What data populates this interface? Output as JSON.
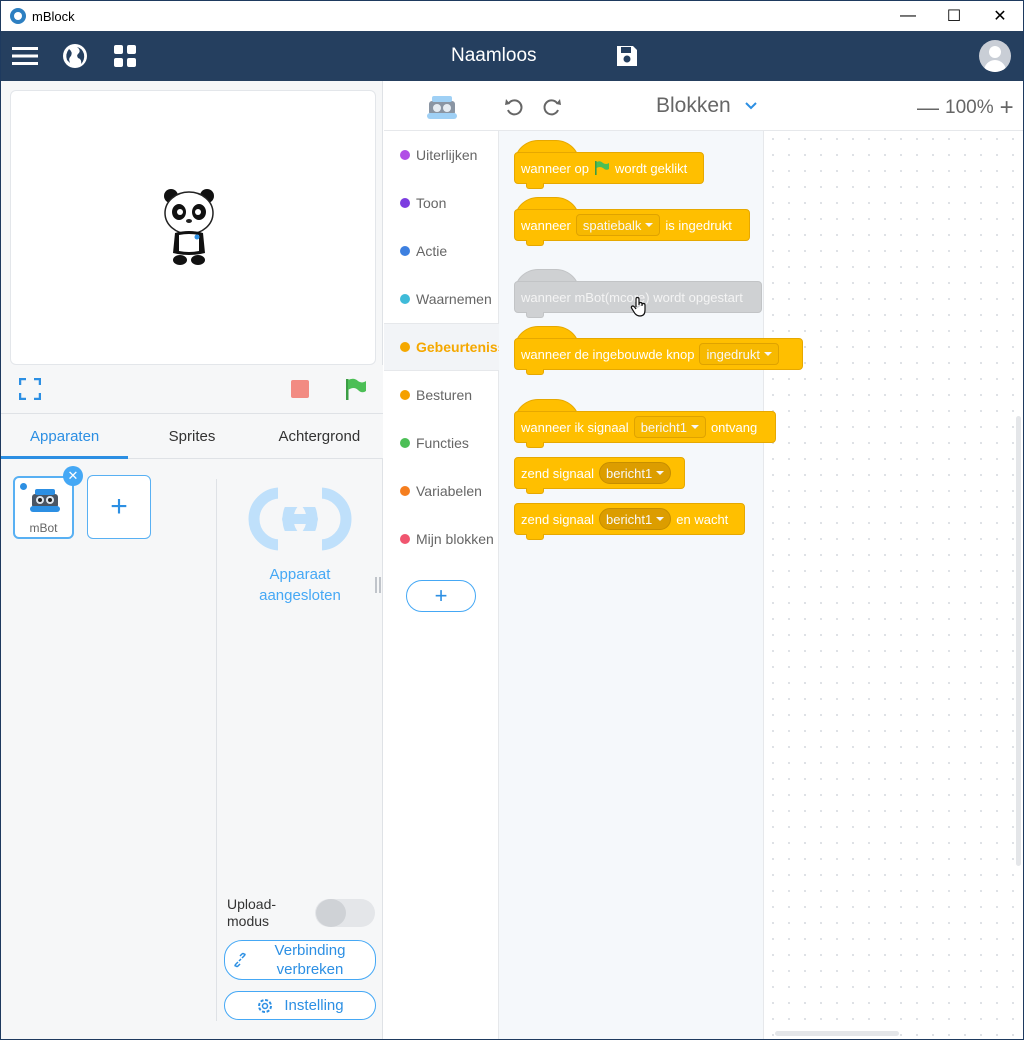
{
  "window": {
    "title": "mBlock",
    "minimize": "—",
    "maximize": "☐",
    "close": "✕"
  },
  "topbar": {
    "doc_title": "Naamloos"
  },
  "tabs": [
    {
      "label": "Apparaten"
    },
    {
      "label": "Sprites"
    },
    {
      "label": "Achtergrond"
    }
  ],
  "device": {
    "name": "mBot"
  },
  "connection": {
    "line1": "Apparaat",
    "line2": "aangesloten"
  },
  "upload": {
    "line1": "Upload-",
    "line2": "modus"
  },
  "buttons": {
    "disconnect_line1": "Verbinding",
    "disconnect_line2": "verbreken",
    "settings": "Instelling"
  },
  "editor": {
    "mode": "Blokken",
    "zoom": "100%"
  },
  "categories": [
    {
      "label": "Uiterlijken",
      "color": "#b14de6"
    },
    {
      "label": "Toon",
      "color": "#7c3de0"
    },
    {
      "label": "Actie",
      "color": "#3d80e0"
    },
    {
      "label": "Waarnemen",
      "color": "#3fbbd9"
    },
    {
      "label": "Gebeurtenissen",
      "color": "#f5a800"
    },
    {
      "label": "Besturen",
      "color": "#f5a000"
    },
    {
      "label": "Functies",
      "color": "#4cbf56"
    },
    {
      "label": "Variabelen",
      "color": "#f57e1f"
    },
    {
      "label": "Mijn blokken",
      "color": "#f0556f"
    }
  ],
  "blocks": {
    "b1": {
      "pre": "wanneer op",
      "post": "wordt geklikt"
    },
    "b2": {
      "pre": "wanneer",
      "dropdown": "spatiebalk",
      "post": "is ingedrukt"
    },
    "b3": {
      "text": "wanneer mBot(mcore) wordt opgestart"
    },
    "b4": {
      "pre": "wanneer de ingebouwde knop",
      "dropdown": "ingedrukt"
    },
    "b5": {
      "pre": "wanneer ik signaal",
      "dropdown": "bericht1",
      "post": "ontvang"
    },
    "b6": {
      "pre": "zend signaal",
      "dropdown": "bericht1"
    },
    "b7": {
      "pre": "zend signaal",
      "dropdown": "bericht1",
      "post": "en wacht"
    }
  },
  "colors": {
    "topbar": "#253f5f",
    "accent": "#2c8fe3",
    "event_block": "#ffbf00",
    "stop": "#f28b82",
    "flag": "#4cbf56"
  }
}
